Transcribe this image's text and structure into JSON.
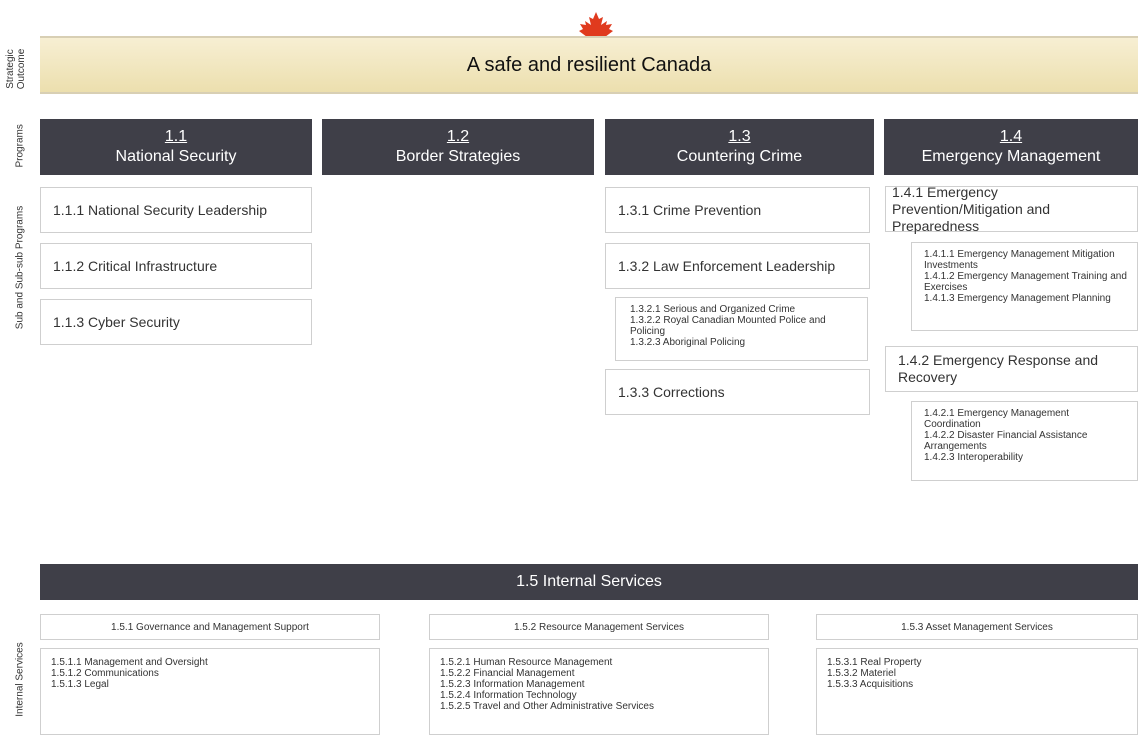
{
  "labels": {
    "strategic_outcome": "Strategic Outcome",
    "programs": "Programs",
    "sub_programs": "Sub and Sub-sub Programs",
    "internal_services": "Internal Services"
  },
  "outcome": "A safe and resilient Canada",
  "colors": {
    "dark": "#3f3f48",
    "leaf": "#e03a1e",
    "outcome_bg": "#f1e6c0"
  },
  "programs": [
    {
      "num": "1.1",
      "name": "National Security"
    },
    {
      "num": "1.2",
      "name": "Border Strategies"
    },
    {
      "num": "1.3",
      "name": "Countering Crime"
    },
    {
      "num": "1.4",
      "name": "Emergency Management"
    }
  ],
  "p11": [
    "1.1.1 National Security Leadership",
    "1.1.2 Critical Infrastructure",
    "1.1.3 Cyber Security"
  ],
  "p13": [
    "1.3.1 Crime Prevention",
    "1.3.2 Law Enforcement Leadership",
    "1.3.3 Corrections"
  ],
  "p132_subs": [
    "1.3.2.1 Serious and Organized Crime",
    "1.3.2.2 Royal Canadian Mounted Police and Policing",
    "1.3.2.3 Aboriginal Policing"
  ],
  "p14": [
    "1.4.1 Emergency Prevention/Mitigation and Preparedness",
    "1.4.2 Emergency Response and Recovery"
  ],
  "p141_subs": [
    "1.4.1.1 Emergency Management Mitigation Investments",
    "1.4.1.2 Emergency Management Training and Exercises",
    "1.4.1.3 Emergency Management Planning"
  ],
  "p142_subs": [
    "1.4.2.1 Emergency Management Coordination",
    "1.4.2.2 Disaster Financial Assistance Arrangements",
    "1.4.2.3 Interoperability"
  ],
  "internal": {
    "title": "1.5 Internal Services",
    "groups": [
      {
        "name": "1.5.1 Governance and Management Support",
        "items": [
          "1.5.1.1 Management and Oversight",
          "1.5.1.2 Communications",
          "1.5.1.3 Legal"
        ]
      },
      {
        "name": "1.5.2 Resource Management Services",
        "items": [
          "1.5.2.1 Human Resource Management",
          "1.5.2.2 Financial Management",
          "1.5.2.3 Information Management",
          "1.5.2.4 Information Technology",
          "1.5.2.5 Travel and Other Administrative Services"
        ]
      },
      {
        "name": "1.5.3 Asset Management Services",
        "items": [
          "1.5.3.1 Real Property",
          "1.5.3.2 Materiel",
          "1.5.3.3 Acquisitions"
        ]
      }
    ]
  }
}
